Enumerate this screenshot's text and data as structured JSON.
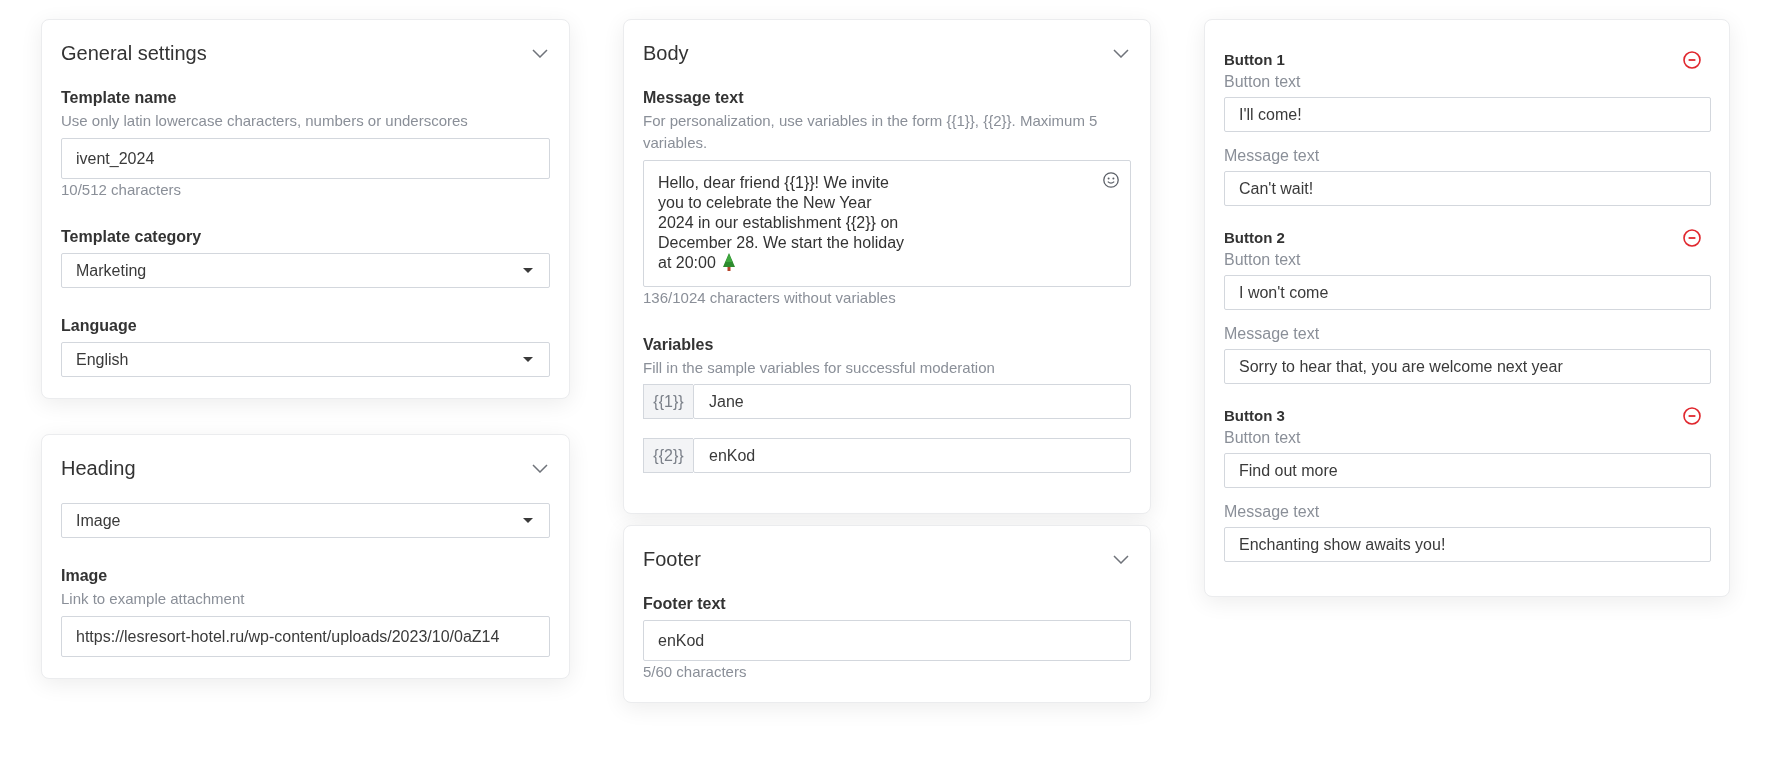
{
  "left_column": {
    "sections": [
      {
        "title": "General settings",
        "fields": [
          {
            "kind": "input",
            "label": "Template name",
            "hint": "Use only latin lowercase characters, numbers or underscores",
            "value": "ivent_2024",
            "counter": "10/512 characters"
          },
          {
            "kind": "select",
            "label": "Template category",
            "value": "Marketing"
          },
          {
            "kind": "select",
            "label": "Language",
            "value": "English"
          }
        ]
      },
      {
        "title": "Heading",
        "fields": [
          {
            "kind": "select",
            "value": "Image"
          },
          {
            "kind": "input",
            "label": "Image",
            "hint": "Link to example attachment",
            "value": "https://lesresort-hotel.ru/wp-content/uploads/2023/10/0aZ14"
          }
        ]
      }
    ]
  },
  "middle_column": {
    "sections": [
      {
        "title": "Body",
        "fields": [
          {
            "kind": "textarea",
            "label": "Message text",
            "hint": "For personalization, use variables in the form {{1}}, {{2}}. Maximum 5 variables.",
            "value": "Hello, dear friend {{1}}! We invite\nyou to celebrate the New Year\n2024 in our establishment {{2}} on\nDecember 28. We start the holiday\nat 20:00",
            "counter": "136/1024 characters without variables"
          },
          {
            "kind": "variables",
            "label": "Variables",
            "hint": "Fill in the sample variables for successful moderation",
            "variables": [
              {
                "name": "{{1}}",
                "value": "Jane"
              },
              {
                "name": "{{2}}",
                "value": "enKod"
              }
            ]
          }
        ]
      },
      {
        "title": "Footer",
        "fields": [
          {
            "kind": "input",
            "label": "Footer text",
            "value": "enKod",
            "counter": "5/60 characters"
          }
        ]
      }
    ]
  },
  "right_column": {
    "button_groups": [
      {
        "title": "Button 1",
        "fields": [
          {
            "label": "Button text",
            "value": "I'll come!"
          },
          {
            "label": "Message text",
            "value": "Can't wait!"
          }
        ]
      },
      {
        "title": "Button 2",
        "fields": [
          {
            "label": "Button text",
            "value": "I won't come"
          },
          {
            "label": "Message text",
            "value": "Sorry to hear that, you are welcome next year"
          }
        ]
      },
      {
        "title": "Button 3",
        "fields": [
          {
            "label": "Button text",
            "value": "Find out more"
          },
          {
            "label": "Message text",
            "value": "Enchanting show awaits you!"
          }
        ]
      }
    ]
  }
}
